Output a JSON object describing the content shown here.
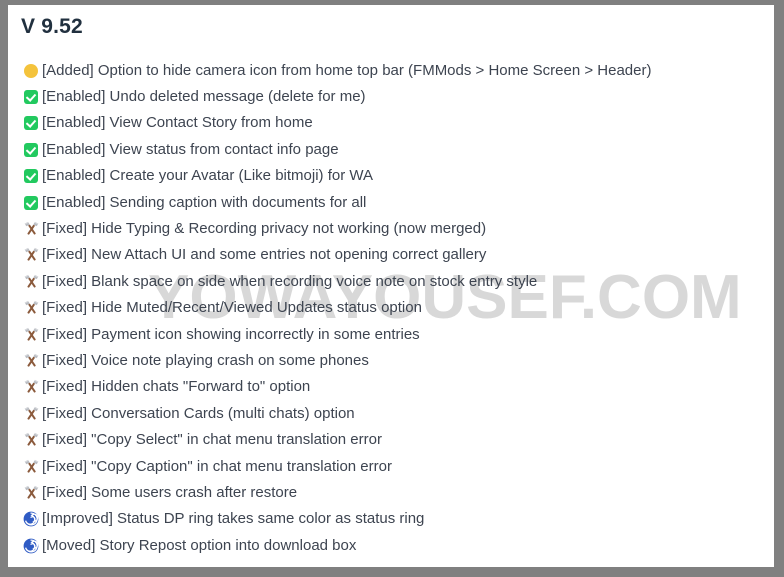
{
  "window": {
    "background_color": "#808080",
    "card_color": "#ffffff"
  },
  "watermark": {
    "text": "YOWAYOUSEF.COM",
    "color": "#d8d8d8"
  },
  "header": {
    "title": "V 9.52",
    "title_color": "#21303f"
  },
  "legend": {
    "added_color": "#f4c33c",
    "enabled_color": "#22c95f",
    "fixed_color": "#8c5a3c",
    "improved_color": "#2b55b5",
    "text_color": "#3d4450"
  },
  "changelog": [
    {
      "icon": "yellow-dot-icon",
      "tag": "Added",
      "text": "[Added] Option to hide camera icon from home top bar (FMMods > Home Screen > Header)"
    },
    {
      "icon": "green-check-icon",
      "tag": "Enabled",
      "text": "[Enabled] Undo deleted message (delete for me)"
    },
    {
      "icon": "green-check-icon",
      "tag": "Enabled",
      "text": "[Enabled] View Contact Story from home"
    },
    {
      "icon": "green-check-icon",
      "tag": "Enabled",
      "text": "[Enabled] View status from contact info page"
    },
    {
      "icon": "green-check-icon",
      "tag": "Enabled",
      "text": "[Enabled] Create your Avatar (Like bitmoji) for WA"
    },
    {
      "icon": "green-check-icon",
      "tag": "Enabled",
      "text": "[Enabled] Sending caption with documents for all"
    },
    {
      "icon": "hammer-and-pick-icon",
      "tag": "Fixed",
      "text": "[Fixed] Hide Typing & Recording privacy not working (now merged)"
    },
    {
      "icon": "hammer-and-pick-icon",
      "tag": "Fixed",
      "text": "[Fixed] New Attach UI and some entries not opening correct gallery"
    },
    {
      "icon": "hammer-and-pick-icon",
      "tag": "Fixed",
      "text": "[Fixed] Blank space on side when recording voice note on stock entry style"
    },
    {
      "icon": "hammer-and-pick-icon",
      "tag": "Fixed",
      "text": "[Fixed] Hide Muted/Recent/Viewed Updates status option"
    },
    {
      "icon": "hammer-and-pick-icon",
      "tag": "Fixed",
      "text": "[Fixed] Payment icon showing incorrectly in some entries"
    },
    {
      "icon": "hammer-and-pick-icon",
      "tag": "Fixed",
      "text": "[Fixed] Voice note playing crash on some phones"
    },
    {
      "icon": "hammer-and-pick-icon",
      "tag": "Fixed",
      "text": "[Fixed] Hidden chats \"Forward to\" option"
    },
    {
      "icon": "hammer-and-pick-icon",
      "tag": "Fixed",
      "text": "[Fixed] Conversation Cards (multi chats) option"
    },
    {
      "icon": "hammer-and-pick-icon",
      "tag": "Fixed",
      "text": "[Fixed] \"Copy Select\" in chat menu translation error"
    },
    {
      "icon": "hammer-and-pick-icon",
      "tag": "Fixed",
      "text": "[Fixed] \"Copy Caption\" in chat menu translation error"
    },
    {
      "icon": "hammer-and-pick-icon",
      "tag": "Fixed",
      "text": "[Fixed] Some users crash after restore"
    },
    {
      "icon": "blue-spiral-icon",
      "tag": "Improved",
      "text": "[Improved] Status DP ring takes same color as status ring"
    },
    {
      "icon": "blue-spiral-icon",
      "tag": "Moved",
      "text": "[Moved] Story Repost option into download box"
    }
  ]
}
